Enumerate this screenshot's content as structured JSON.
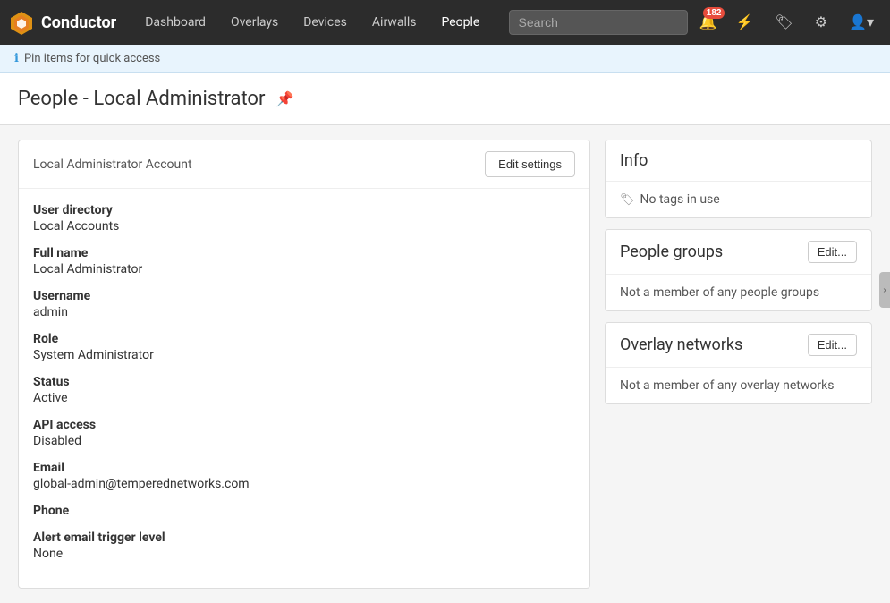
{
  "brand": {
    "name": "Conductor"
  },
  "nav": {
    "links": [
      {
        "label": "Dashboard",
        "name": "dashboard",
        "active": false
      },
      {
        "label": "Overlays",
        "name": "overlays",
        "active": false
      },
      {
        "label": "Devices",
        "name": "devices",
        "active": false
      },
      {
        "label": "Airwalls",
        "name": "airwalls",
        "active": false
      },
      {
        "label": "People",
        "name": "people",
        "active": true
      }
    ],
    "search_placeholder": "Search",
    "notification_count": "182"
  },
  "pin_bar": {
    "text": "Pin items for quick access"
  },
  "page": {
    "title": "People - Local Administrator"
  },
  "left_panel": {
    "account_label": "Local Administrator Account",
    "edit_btn": "Edit settings",
    "fields": [
      {
        "label": "User directory",
        "value": "Local Accounts"
      },
      {
        "label": "Full name",
        "value": "Local Administrator"
      },
      {
        "label": "Username",
        "value": "admin"
      },
      {
        "label": "Role",
        "value": "System Administrator"
      },
      {
        "label": "Status",
        "value": "Active"
      },
      {
        "label": "API access",
        "value": "Disabled"
      },
      {
        "label": "Email",
        "value": "global-admin@temperednetworks.com"
      },
      {
        "label": "Phone",
        "value": ""
      },
      {
        "label": "Alert email trigger level",
        "value": "None"
      }
    ]
  },
  "right_panels": {
    "info": {
      "title": "Info",
      "no_tags_text": "No tags in use"
    },
    "people_groups": {
      "title": "People groups",
      "edit_btn": "Edit...",
      "body_text": "Not a member of any people groups"
    },
    "overlay_networks": {
      "title": "Overlay networks",
      "edit_btn": "Edit...",
      "body_text": "Not a member of any overlay networks"
    }
  }
}
